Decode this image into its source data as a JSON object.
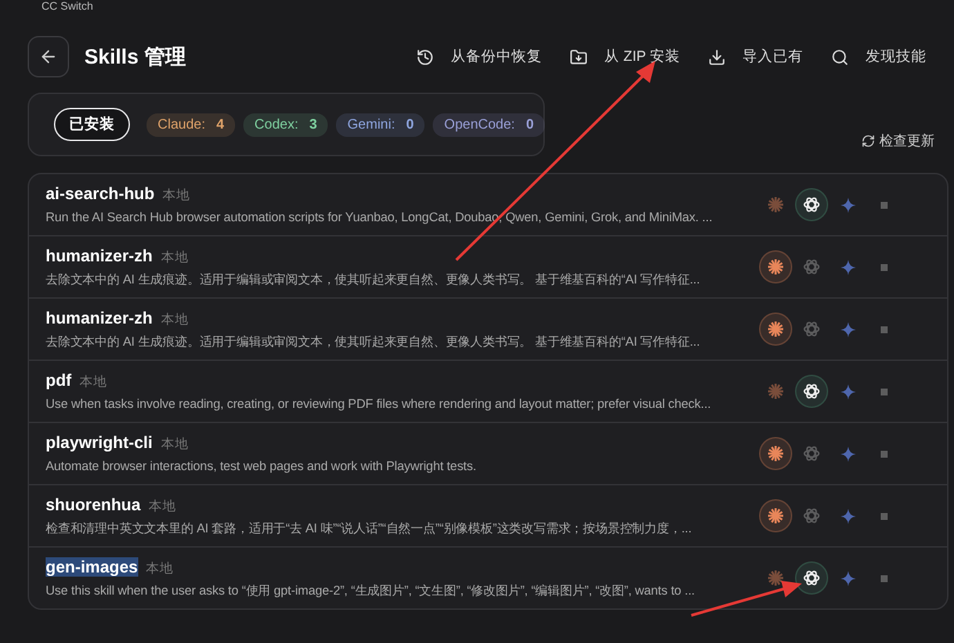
{
  "window": {
    "title": "CC Switch"
  },
  "header": {
    "title": "Skills 管理",
    "actions": [
      {
        "kind": "restore",
        "label": "从备份中恢复"
      },
      {
        "kind": "zip",
        "label": "从 ZIP 安装"
      },
      {
        "kind": "import",
        "label": "导入已有"
      },
      {
        "kind": "discover",
        "label": "发现技能"
      }
    ]
  },
  "filter": {
    "tab": {
      "label": "已安装",
      "selected": true
    },
    "badges": [
      {
        "name": "Claude:",
        "count": "4",
        "color": "#e0a36a"
      },
      {
        "name": "Codex:",
        "count": "3",
        "color": "#7fd1a0"
      },
      {
        "name": "Gemini:",
        "count": "0",
        "color": "#8fa6e0"
      },
      {
        "name": "OpenCode:",
        "count": "0",
        "color": "#9aa0d8"
      }
    ]
  },
  "check_update": "检查更新",
  "skills": [
    {
      "name": "ai-search-hub",
      "source": "本地",
      "name_selected": false,
      "description": "Run the AI Search Hub browser automation scripts for Yuanbao, LongCat, Doubao, Qwen, Gemini, Grok, and MiniMax. ...",
      "apps": [
        {
          "kind": "claude",
          "on": false
        },
        {
          "kind": "codex",
          "on": true
        },
        {
          "kind": "gemini",
          "on": false
        },
        {
          "kind": "opencode",
          "on": false
        }
      ]
    },
    {
      "name": "humanizer-zh",
      "source": "本地",
      "name_selected": false,
      "description": "去除文本中的 AI 生成痕迹。适用于编辑或审阅文本，使其听起来更自然、更像人类书写。 基于维基百科的“AI 写作特征...",
      "apps": [
        {
          "kind": "claude",
          "on": true
        },
        {
          "kind": "codex",
          "on": false
        },
        {
          "kind": "gemini",
          "on": false
        },
        {
          "kind": "opencode",
          "on": false
        }
      ]
    },
    {
      "name": "humanizer-zh",
      "source": "本地",
      "name_selected": false,
      "description": "去除文本中的 AI 生成痕迹。适用于编辑或审阅文本，使其听起来更自然、更像人类书写。 基于维基百科的“AI 写作特征...",
      "apps": [
        {
          "kind": "claude",
          "on": true
        },
        {
          "kind": "codex",
          "on": false
        },
        {
          "kind": "gemini",
          "on": false
        },
        {
          "kind": "opencode",
          "on": false
        }
      ]
    },
    {
      "name": "pdf",
      "source": "本地",
      "name_selected": false,
      "description": "Use when tasks involve reading, creating, or reviewing PDF files where rendering and layout matter; prefer visual check...",
      "apps": [
        {
          "kind": "claude",
          "on": false
        },
        {
          "kind": "codex",
          "on": true
        },
        {
          "kind": "gemini",
          "on": false
        },
        {
          "kind": "opencode",
          "on": false
        }
      ]
    },
    {
      "name": "playwright-cli",
      "source": "本地",
      "name_selected": false,
      "description": "Automate browser interactions, test web pages and work with Playwright tests.",
      "apps": [
        {
          "kind": "claude",
          "on": true
        },
        {
          "kind": "codex",
          "on": false
        },
        {
          "kind": "gemini",
          "on": false
        },
        {
          "kind": "opencode",
          "on": false
        }
      ]
    },
    {
      "name": "shuorenhua",
      "source": "本地",
      "name_selected": false,
      "description": "检查和清理中英文文本里的 AI 套路，适用于“去 AI 味”“说人话”“自然一点”“别像模板”这类改写需求；按场景控制力度，...",
      "apps": [
        {
          "kind": "claude",
          "on": true
        },
        {
          "kind": "codex",
          "on": false
        },
        {
          "kind": "gemini",
          "on": false
        },
        {
          "kind": "opencode",
          "on": false
        }
      ]
    },
    {
      "name": "gen-images",
      "source": "本地",
      "name_selected": true,
      "description": "Use this skill when the user asks to “使用 gpt-image-2”, “生成图片”, “文生图”, “修改图片”, “编辑图片”, “改图”, wants to ...",
      "apps": [
        {
          "kind": "claude",
          "on": false
        },
        {
          "kind": "codex",
          "on": true
        },
        {
          "kind": "gemini",
          "on": false
        },
        {
          "kind": "opencode",
          "on": false
        }
      ]
    }
  ]
}
